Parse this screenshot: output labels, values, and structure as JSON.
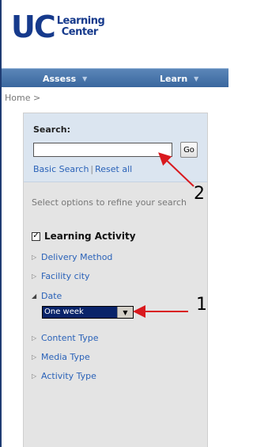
{
  "logo": {
    "mark": "UC",
    "line1": "Learning",
    "line2": "Center"
  },
  "nav": {
    "assess_label": "Assess",
    "learn_label": "Learn",
    "caret": "▼"
  },
  "breadcrumb": "Home >",
  "search": {
    "label": "Search:",
    "value": "",
    "go_label": "Go",
    "basic_search": "Basic Search",
    "separator": "|",
    "reset_all": "Reset all"
  },
  "refine_hint": "Select options to refine your search",
  "facets": {
    "learning_activity": "Learning Activity",
    "learning_activity_checked": true,
    "checkmark": "✓",
    "items": [
      {
        "label": "Delivery Method",
        "expanded": false
      },
      {
        "label": "Facility city",
        "expanded": false
      },
      {
        "label": "Date",
        "expanded": true
      },
      {
        "label": "Content Type",
        "expanded": false
      },
      {
        "label": "Media Type",
        "expanded": false
      },
      {
        "label": "Activity Type",
        "expanded": false
      }
    ],
    "collapsed_icon": "▷",
    "expanded_icon": "◢"
  },
  "date_select": {
    "selected": "One week",
    "dropdown_glyph": "▼"
  },
  "annotations": [
    {
      "number": "1",
      "color": "#d9191e"
    },
    {
      "number": "2",
      "color": "#d9191e"
    }
  ]
}
